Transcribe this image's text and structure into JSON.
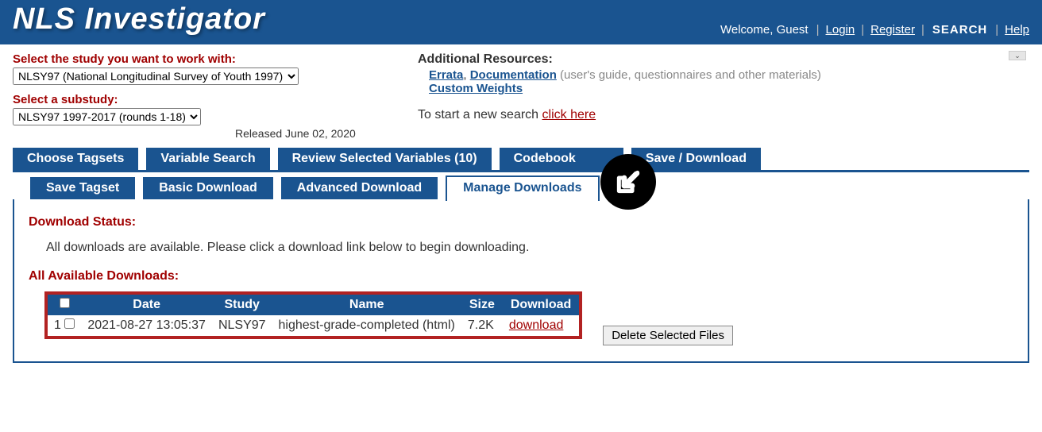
{
  "header": {
    "logo": "NLS Investigator",
    "welcome": "Welcome, Guest",
    "login": "Login",
    "register": "Register",
    "search": "SEARCH",
    "help": "Help"
  },
  "study": {
    "label": "Select the study you want to work with:",
    "value": "NLSY97 (National Longitudinal Survey of Youth 1997)"
  },
  "substudy": {
    "label": "Select a substudy:",
    "value": "NLSY97 1997-2017 (rounds 1-18)",
    "released": "Released June 02, 2020"
  },
  "resources": {
    "title": "Additional Resources:",
    "errata": "Errata",
    "documentation": "Documentation",
    "doc_note": "(user's guide, questionnaires and other materials)",
    "custom_weights": "Custom Weights",
    "start": "To start a new search ",
    "start_link": "click here"
  },
  "tabs_main": {
    "choose": "Choose Tagsets",
    "variable": "Variable Search",
    "review": "Review Selected Variables (10)",
    "codebook": "Codebook",
    "save": "Save / Download"
  },
  "tabs_sub": {
    "save_tagset": "Save Tagset",
    "basic": "Basic Download",
    "advanced": "Advanced Download",
    "manage": "Manage Downloads"
  },
  "download": {
    "status_title": "Download Status:",
    "status_msg": "All downloads are available. Please click a download link below to begin downloading.",
    "avail_title": "All Available Downloads:",
    "headers": {
      "date": "Date",
      "study": "Study",
      "name": "Name",
      "size": "Size",
      "dl": "Download"
    },
    "row": {
      "num": "1",
      "date": "2021-08-27 13:05:37",
      "study": "NLSY97",
      "name": "highest-grade-completed (html)",
      "size": "7.2K",
      "link": "download"
    },
    "delete_btn": "Delete Selected Files"
  }
}
